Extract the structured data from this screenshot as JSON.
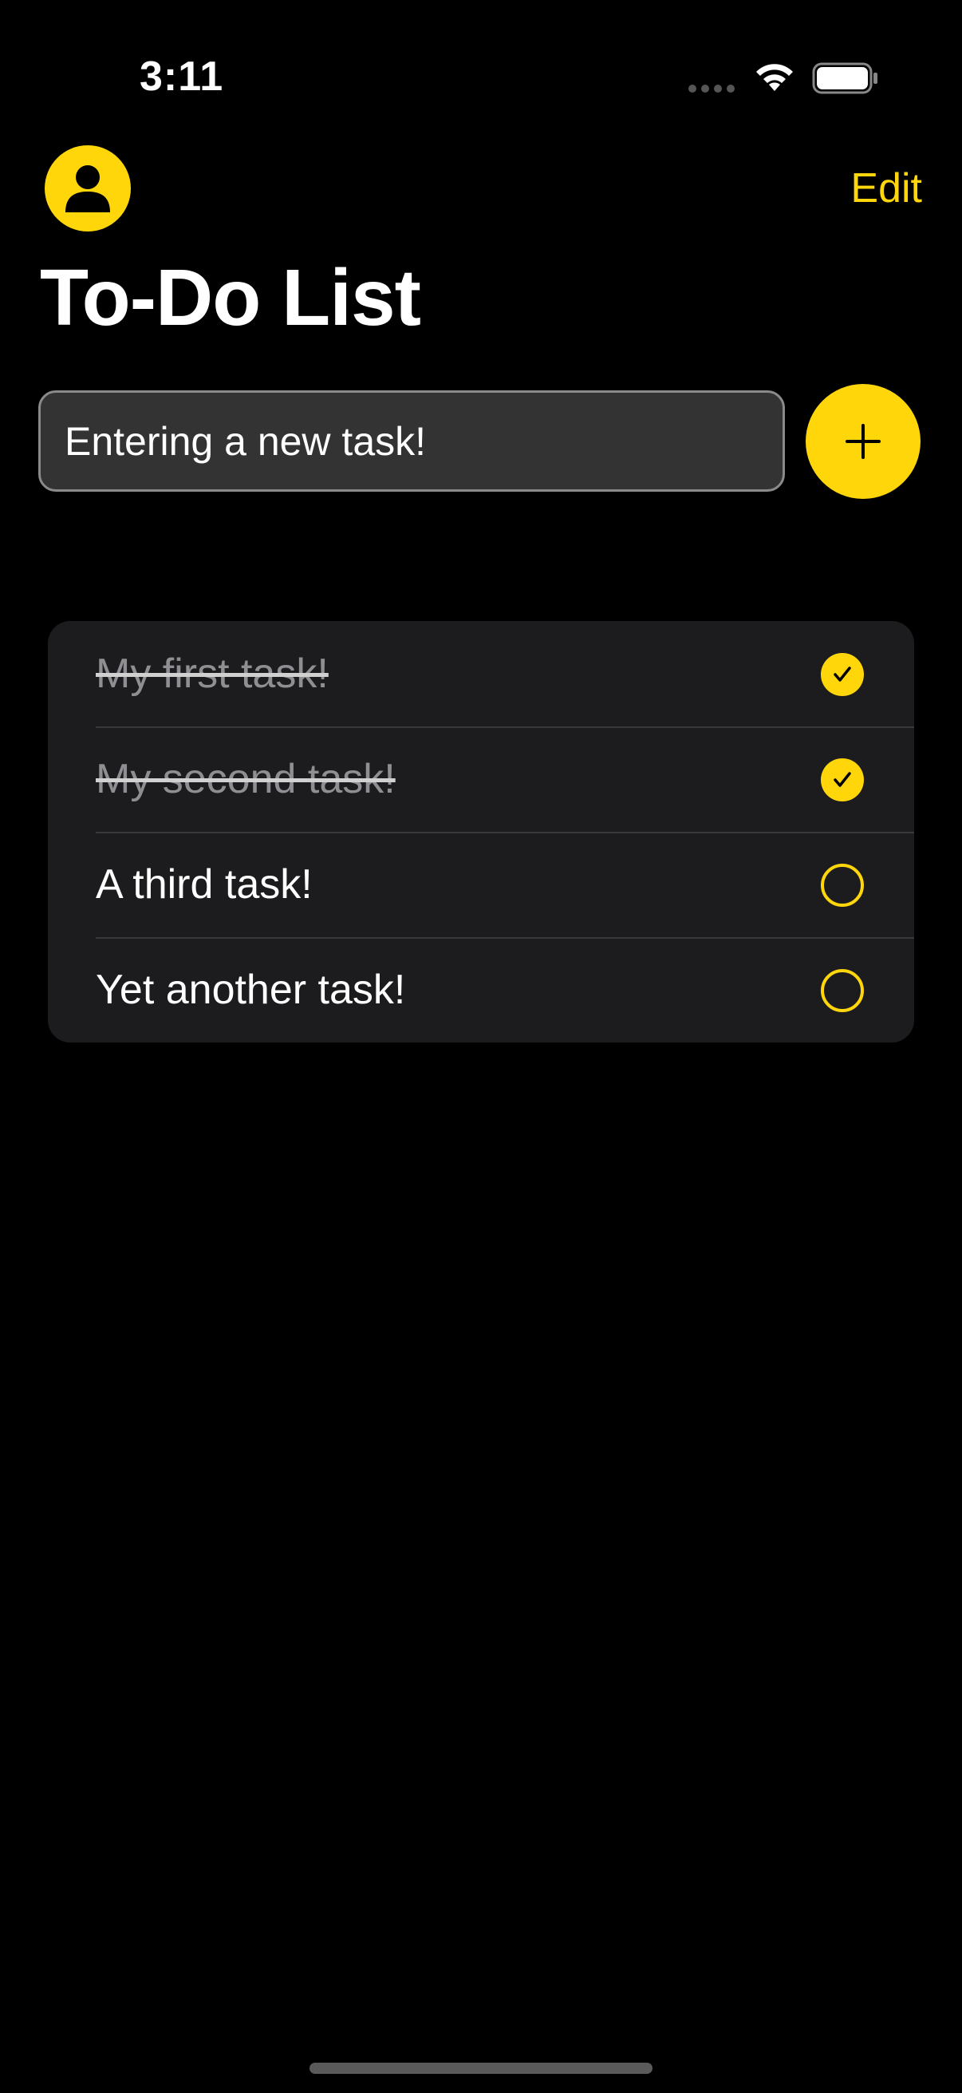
{
  "status_bar": {
    "time": "3:11"
  },
  "header": {
    "edit_label": "Edit",
    "title": "To-Do List"
  },
  "new_task": {
    "value": "Entering a new task!"
  },
  "colors": {
    "accent": "#FFD60A",
    "background": "#000000",
    "card": "#1c1c1e"
  },
  "icons": {
    "avatar": "person-icon",
    "add": "plus-icon",
    "done": "checkmark-icon"
  },
  "tasks": [
    {
      "label": "My first task!",
      "done": true
    },
    {
      "label": "My second task!",
      "done": true
    },
    {
      "label": "A third task!",
      "done": false
    },
    {
      "label": "Yet another task!",
      "done": false
    }
  ]
}
